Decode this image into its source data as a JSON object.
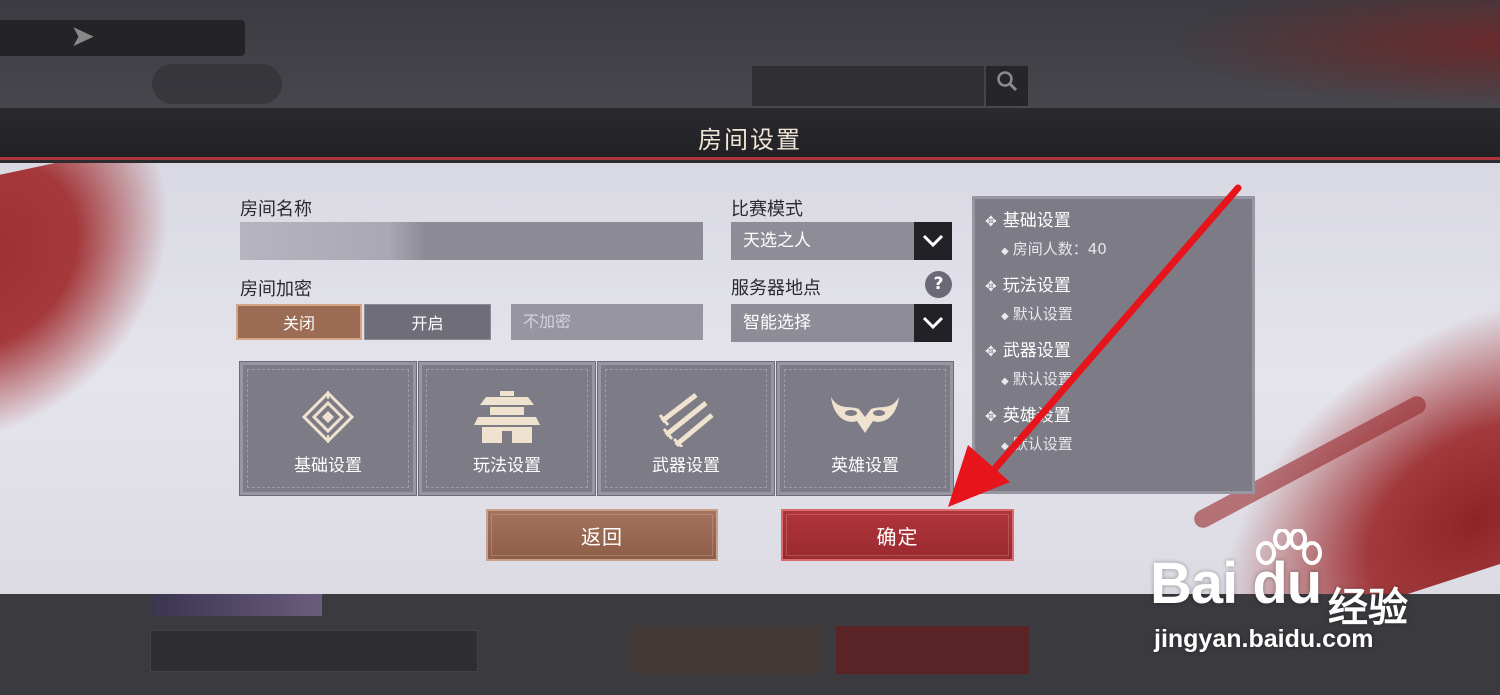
{
  "background": {
    "search_icon": "search-icon"
  },
  "dialog": {
    "title": "房间设置",
    "room_name": {
      "label": "房间名称",
      "value": ""
    },
    "encryption": {
      "label": "房间加密",
      "off_label": "关闭",
      "on_label": "开启",
      "selected": "关闭",
      "password_placeholder": "不加密"
    },
    "match_mode": {
      "label": "比赛模式",
      "selected": "天选之人"
    },
    "server_location": {
      "label": "服务器地点",
      "selected": "智能选择",
      "help_glyph": "?"
    },
    "tiles": [
      {
        "label": "基础设置",
        "icon": "diamond-emblem-icon"
      },
      {
        "label": "玩法设置",
        "icon": "pagoda-icon"
      },
      {
        "label": "武器设置",
        "icon": "swords-icon"
      },
      {
        "label": "英雄设置",
        "icon": "mask-icon"
      }
    ],
    "summary": {
      "sections": [
        {
          "title": "基础设置",
          "item": "房间人数：40"
        },
        {
          "title": "玩法设置",
          "item": "默认设置"
        },
        {
          "title": "武器设置",
          "item": "默认设置"
        },
        {
          "title": "英雄设置",
          "item": "默认设置"
        }
      ]
    },
    "buttons": {
      "back": "返回",
      "confirm": "确定"
    }
  },
  "watermark": {
    "brand": "Bai du",
    "brand_cn": "经验",
    "url": "jingyan.baidu.com"
  },
  "colors": {
    "accent_red": "#b0353a",
    "header_bg": "#222226",
    "panel_bg": "#7c7b86",
    "back_button": "#9c6c55",
    "annotation_arrow": "#e8141b"
  }
}
